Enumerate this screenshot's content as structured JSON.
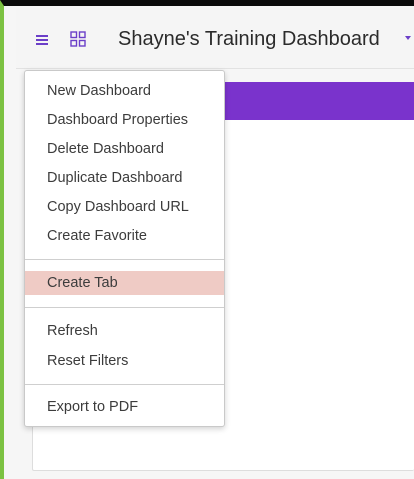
{
  "header": {
    "title": "Shayne's Training Dashboard",
    "menu_icon": "hamburger-icon",
    "apps_icon": "grid-icon",
    "dropdown_icon": "caret-down-icon"
  },
  "dashboard_menu": {
    "groups": [
      [
        "New Dashboard",
        "Dashboard Properties",
        "Delete Dashboard",
        "Duplicate Dashboard",
        "Copy Dashboard URL",
        "Create Favorite"
      ],
      [
        "Create Tab"
      ],
      [
        "Refresh",
        "Reset Filters"
      ],
      [
        "Export to PDF"
      ]
    ],
    "highlighted_item": "Create Tab"
  },
  "colors": {
    "accent": "#6b3fc8",
    "banner": "#7a33cc",
    "highlight": "#efcbc5",
    "frame_green": "#7cc242"
  }
}
